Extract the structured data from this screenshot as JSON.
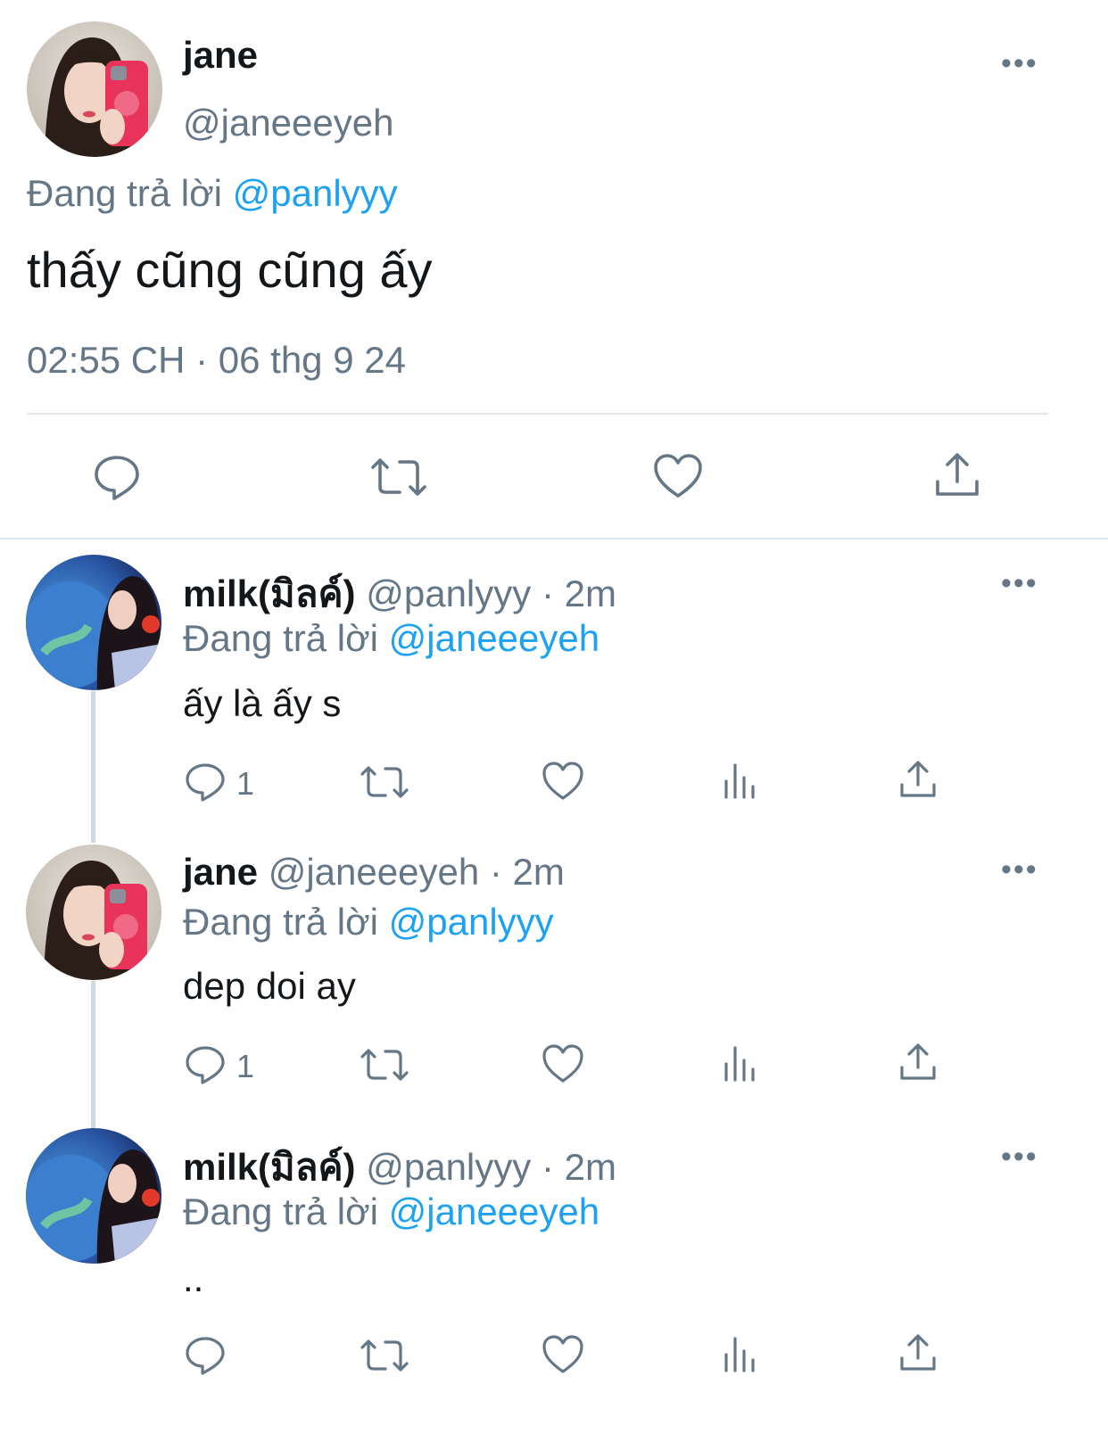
{
  "main_tweet": {
    "display_name": "jane",
    "handle": "@janeeeyeh",
    "more_icon": "more-horizontal-icon",
    "reply_prefix": "Đang trả lời",
    "reply_to": "@panlyyy",
    "text": "thấy cũng cũng ấy",
    "timestamp": "02:55 CH · 06 thg 9 24",
    "actions": [
      "reply-icon",
      "retweet-icon",
      "like-icon",
      "share-icon"
    ]
  },
  "replies": [
    {
      "display_name": "milk(มิลค์)",
      "handle": "@panlyyy",
      "time": "· 2m",
      "reply_prefix": "Đang trả lời",
      "reply_to": "@janeeeyeh",
      "text": "ấy là ấy s",
      "reply_count": "1"
    },
    {
      "display_name": "jane",
      "handle": "@janeeeyeh",
      "time": "· 2m",
      "reply_prefix": "Đang trả lời",
      "reply_to": "@panlyyy",
      "text": "dep doi ay",
      "reply_count": "1"
    },
    {
      "display_name": "milk(มิลค์)",
      "handle": "@panlyyy",
      "time": "· 2m",
      "reply_prefix": "Đang trả lời",
      "reply_to": "@janeeeyeh",
      "text": "..",
      "reply_count": ""
    }
  ],
  "colors": {
    "accent": "#1da1f2",
    "muted": "#657786",
    "text": "#14171a",
    "divider": "#e1e8ed"
  }
}
